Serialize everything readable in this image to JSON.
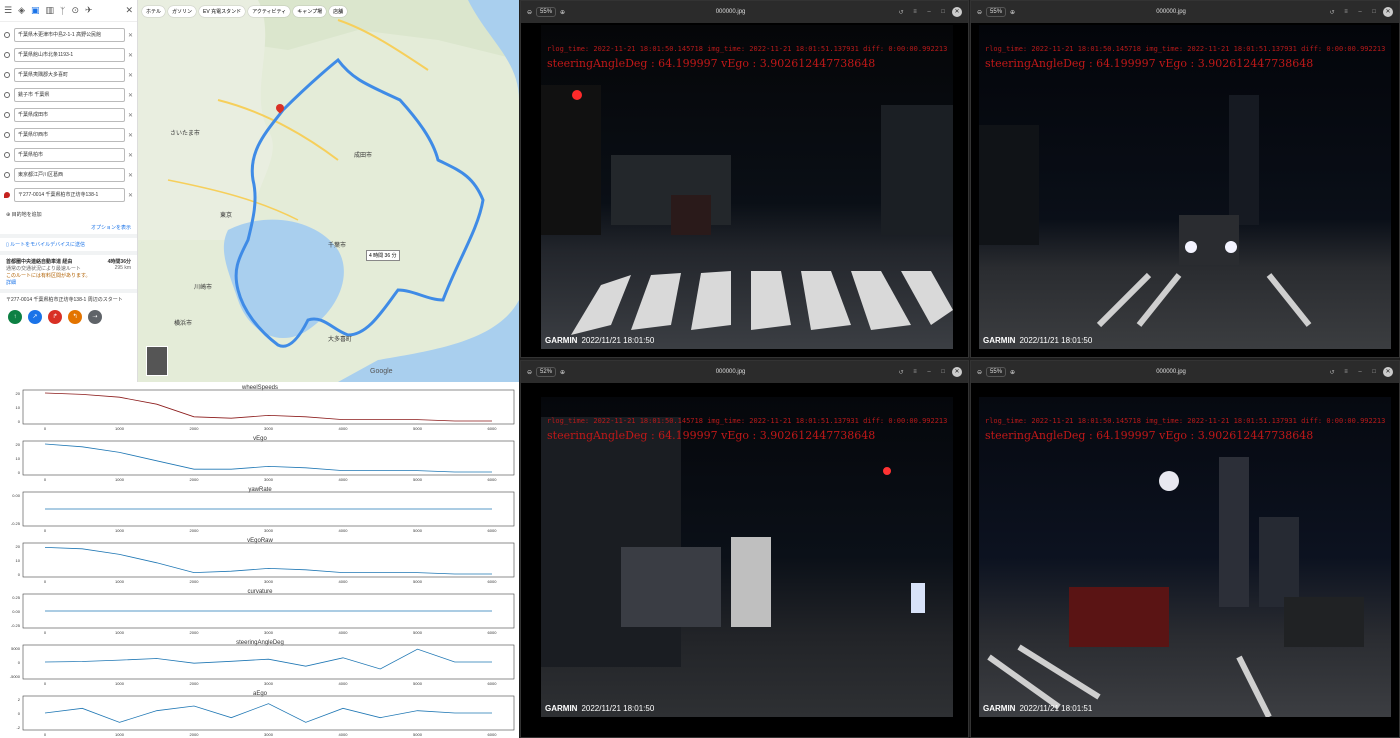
{
  "maps": {
    "waypoints": [
      "千葉県木更津市中島2-1-1 高野公民館",
      "千葉県館山市北条1193-1",
      "千葉県夷隅郡大多喜町",
      "銚子市 千葉県",
      "千葉県成田市",
      "千葉県印西市",
      "千葉県柏市",
      "東京都江戸川区葛西",
      "〒277-0014 千葉県柏市正坊寺138-1"
    ],
    "add_destination": "目的地を追加",
    "options_link": "オプションを表示",
    "send_to_device": "ルートをモバイルデバイスに送信",
    "route_name": "首都圏中央連絡自動車道 経由",
    "route_time": "4時間36分",
    "route_note": "通常の交通状況により最速ルート",
    "route_distance": "295 km",
    "route_warning": "このルートには有料区間があります。",
    "details_link": "詳細",
    "start_address": "〒277-0014 千葉県柏市正坊寺138-1 周辺のスタート",
    "mode_chips": [
      "ホテル",
      "ガソリン",
      "EV 充電スタンド",
      "アクティビティ",
      "キャンプ場",
      "店舗"
    ],
    "map_duration_badge": "4 時間 36 分",
    "map_labels": [
      "さいたま市",
      "川崎市",
      "横浜市",
      "千葉市",
      "成田市",
      "東京",
      "大多喜町"
    ],
    "google_logo": "Google"
  },
  "plots": [
    {
      "title": "wheelSpeeds",
      "yticks": [
        "20",
        "10",
        "0"
      ]
    },
    {
      "title": "vEgo",
      "yticks": [
        "20",
        "10",
        "0"
      ]
    },
    {
      "title": "yawRate",
      "yticks": [
        "0.00",
        "-0.25"
      ]
    },
    {
      "title": "vEgoRaw",
      "yticks": [
        "20",
        "10",
        "0"
      ]
    },
    {
      "title": "curvature",
      "yticks": [
        "0.25",
        "0.00",
        "-0.25"
      ]
    },
    {
      "title": "steeringAngleDeg",
      "yticks": [
        "5000",
        "0",
        "-5000"
      ]
    },
    {
      "title": "aEgo",
      "yticks": [
        "2",
        "0",
        "-2"
      ]
    }
  ],
  "xticks": [
    "0",
    "1000",
    "2000",
    "3000",
    "4000",
    "5000",
    "6000"
  ],
  "viewers": [
    {
      "zoom": "55%",
      "filename": "000000.jpg",
      "overlay_line1": "rlog_time: 2022-11-21 18:01:50.145718   img_time: 2022-11-21 18:01:51.137931   diff: 0:00:00.992213",
      "overlay_line2": "steeringAngleDeg : 64.199997     vEgo : 3.902612447738648",
      "brand": "GARMIN",
      "stamp": "2022/11/21 18:01:50"
    },
    {
      "zoom": "55%",
      "filename": "000000.jpg",
      "overlay_line1": "rlog_time: 2022-11-21 18:01:50.145718   img_time: 2022-11-21 18:01:51.137931   diff: 0:00:00.992213",
      "overlay_line2": "steeringAngleDeg : 64.199997     vEgo : 3.902612447738648",
      "brand": "GARMIN",
      "stamp": "2022/11/21 18:01:50"
    },
    {
      "zoom": "52%",
      "filename": "000000.jpg",
      "overlay_line1": "rlog_time: 2022-11-21 18:01:50.145718   img_time: 2022-11-21 18:01:51.137931   diff: 0:00:00.992213",
      "overlay_line2": "steeringAngleDeg : 64.199997     vEgo : 3.902612447738648",
      "brand": "GARMIN",
      "stamp": "2022/11/21 18:01:50"
    },
    {
      "zoom": "55%",
      "filename": "000000.jpg",
      "overlay_line1": "rlog_time: 2022-11-21 18:01:50.145718   img_time: 2022-11-21 18:01:51.137931   diff: 0:00:00.992213",
      "overlay_line2": "steeringAngleDeg : 64.199997     vEgo : 3.902612447738648",
      "brand": "GARMIN",
      "stamp": "2022/11/21 18:01:51"
    }
  ],
  "chart_data": [
    {
      "type": "line",
      "title": "wheelSpeeds",
      "x": [
        0,
        500,
        1000,
        1500,
        2000,
        2500,
        3000,
        3500,
        4000,
        4500,
        5000,
        5500,
        6000
      ],
      "series": [
        {
          "values": [
            20,
            19,
            17,
            12,
            3,
            2,
            4,
            3,
            1,
            1,
            1,
            0,
            0
          ]
        }
      ],
      "xlim": [
        0,
        6000
      ],
      "ylim": [
        0,
        20
      ]
    },
    {
      "type": "line",
      "title": "vEgo",
      "x": [
        0,
        500,
        1000,
        1500,
        2000,
        2500,
        3000,
        3500,
        4000,
        4500,
        5000,
        5500,
        6000
      ],
      "series": [
        {
          "values": [
            20,
            18,
            14,
            8,
            2,
            2,
            4,
            3,
            1,
            1,
            1,
            0,
            0
          ]
        }
      ],
      "xlim": [
        0,
        6000
      ],
      "ylim": [
        0,
        20
      ]
    },
    {
      "type": "line",
      "title": "yawRate",
      "x": [
        0,
        6000
      ],
      "series": [
        {
          "values": [
            0,
            0
          ]
        }
      ],
      "xlim": [
        0,
        6000
      ],
      "ylim": [
        -0.25,
        0.25
      ]
    },
    {
      "type": "line",
      "title": "vEgoRaw",
      "x": [
        0,
        500,
        1000,
        1500,
        2000,
        2500,
        3000,
        3500,
        4000,
        4500,
        5000,
        5500,
        6000
      ],
      "series": [
        {
          "values": [
            19,
            18,
            14,
            8,
            1,
            2,
            4,
            3,
            1,
            1,
            1,
            0,
            0
          ]
        }
      ],
      "xlim": [
        0,
        6000
      ],
      "ylim": [
        0,
        20
      ]
    },
    {
      "type": "line",
      "title": "curvature",
      "x": [
        0,
        6000
      ],
      "series": [
        {
          "values": [
            0,
            0
          ]
        }
      ],
      "xlim": [
        0,
        6000
      ],
      "ylim": [
        -0.25,
        0.25
      ]
    },
    {
      "type": "line",
      "title": "steeringAngleDeg",
      "x": [
        0,
        500,
        1000,
        1500,
        2000,
        2500,
        3000,
        3500,
        4000,
        4500,
        5000,
        5500,
        6000
      ],
      "series": [
        {
          "values": [
            0,
            200,
            800,
            1500,
            -500,
            300,
            1200,
            -1800,
            1800,
            -3000,
            5500,
            0,
            0
          ]
        }
      ],
      "xlim": [
        0,
        6000
      ],
      "ylim": [
        -6000,
        6000
      ]
    },
    {
      "type": "line",
      "title": "aEgo",
      "x": [
        0,
        500,
        1000,
        1500,
        2000,
        2500,
        3000,
        3500,
        4000,
        4500,
        5000,
        5500,
        6000
      ],
      "series": [
        {
          "values": [
            0,
            1,
            -2,
            0.5,
            1.5,
            -1,
            2,
            -2,
            1,
            -1,
            0.5,
            0,
            0
          ]
        }
      ],
      "xlim": [
        0,
        6000
      ],
      "ylim": [
        -3,
        3
      ]
    }
  ]
}
